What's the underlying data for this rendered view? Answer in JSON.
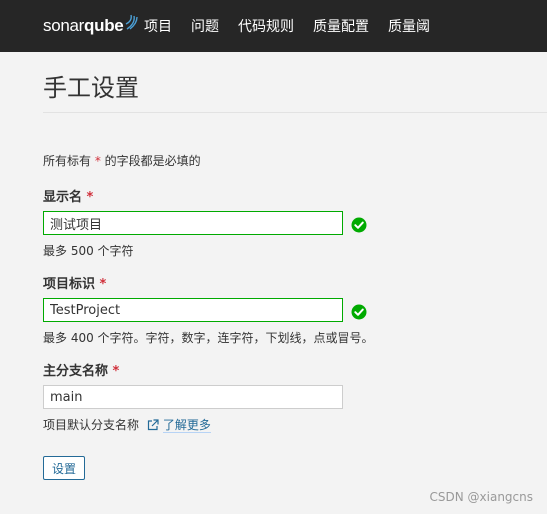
{
  "header": {
    "logo_text_light": "sonar",
    "logo_text_bold": "qube",
    "nav": [
      "项目",
      "问题",
      "代码规则",
      "质量配置",
      "质量阈"
    ]
  },
  "page": {
    "title": "手工设置",
    "required_hint_prefix": "所有标有 ",
    "required_star": "*",
    "required_hint_suffix": " 的字段都是必填的"
  },
  "form": {
    "display_name": {
      "label": "显示名",
      "required": "*",
      "value": "测试项目",
      "help": "最多 500 个字符",
      "valid": true
    },
    "project_key": {
      "label": "项目标识",
      "required": "*",
      "value": "TestProject",
      "help": "最多 400 个字符。字符，数字，连字符，下划线，点或冒号。",
      "valid": true
    },
    "main_branch": {
      "label": "主分支名称",
      "required": "*",
      "value": "main",
      "help": "项目默认分支名称",
      "link": "了解更多"
    },
    "submit_label": "设置"
  },
  "watermark": "CSDN @xiangcns",
  "colors": {
    "topbar": "#262626",
    "valid": "#00aa00",
    "required": "#d02f3a",
    "link": "#236a97"
  }
}
